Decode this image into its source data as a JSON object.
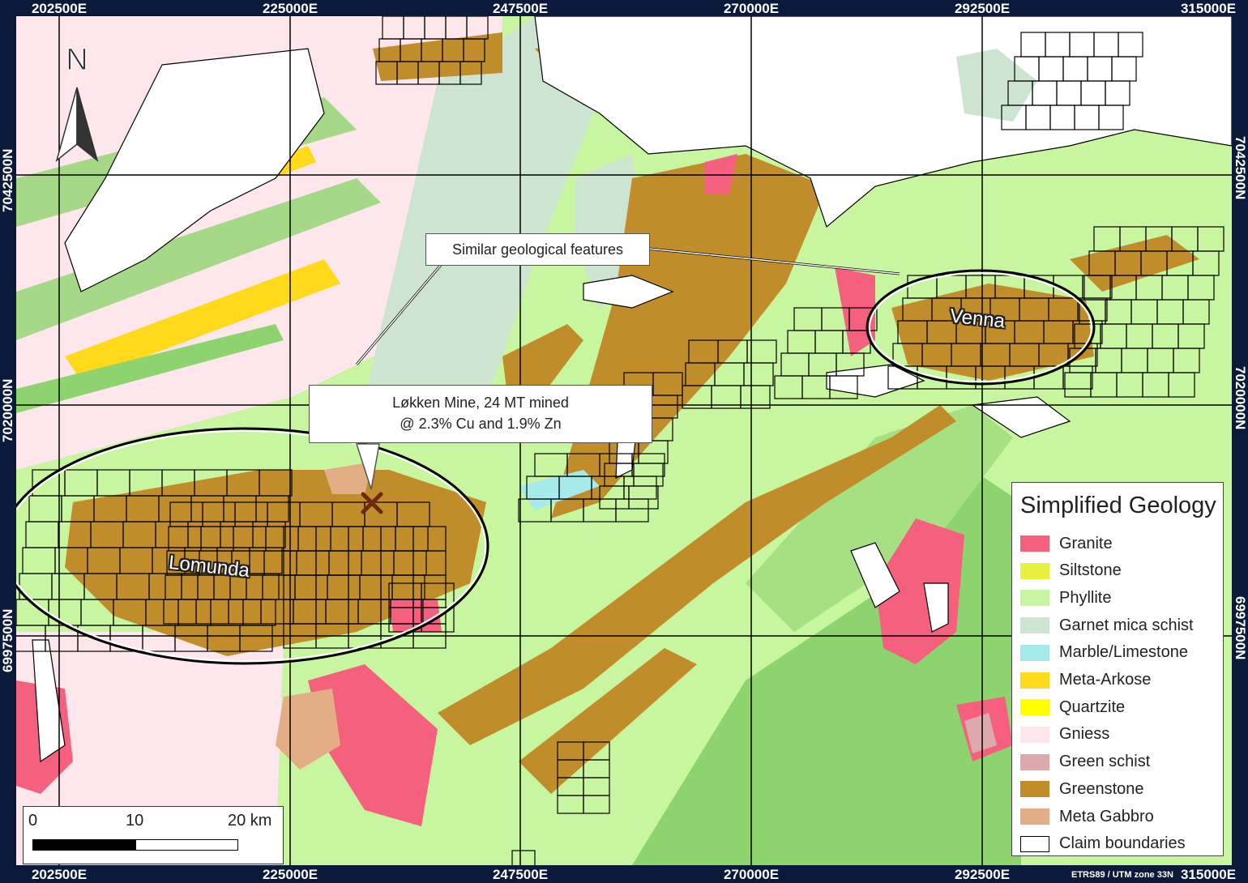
{
  "coordinates": {
    "top_x": [
      "202500E",
      "225000E",
      "247500E",
      "270000E",
      "292500E",
      "315000E"
    ],
    "bottom_x": [
      "202500E",
      "225000E",
      "247500E",
      "270000E",
      "292500E",
      "315000E"
    ],
    "left_y": [
      "7042500N",
      "7020000N",
      "6997500N"
    ],
    "right_y": [
      "7042500N",
      "7020000N",
      "6997500N"
    ]
  },
  "crs_label": "ETRS89 / UTM zone 33N",
  "north_arrow": {
    "label": "N",
    "icon": "north-arrow-icon"
  },
  "callouts": {
    "similar": "Similar geological features",
    "mine_line1": "Løkken Mine, 24 MT mined",
    "mine_line2": "@ 2.3% Cu and 1.9% Zn"
  },
  "deposits": {
    "lomunda": "Lomunda",
    "venna": "Venna"
  },
  "mine_icon": "mine-pickaxes-icon",
  "legend": {
    "title": "Simplified Geology",
    "items": [
      {
        "label": "Granite",
        "color": "#f4607e"
      },
      {
        "label": "Siltstone",
        "color": "#e6f23c"
      },
      {
        "label": "Phyllite",
        "color": "#c8f5a0"
      },
      {
        "label": "Garnet mica schist",
        "color": "#cde4d0"
      },
      {
        "label": "Marble/Limestone",
        "color": "#a6ebeb"
      },
      {
        "label": "Meta-Arkose",
        "color": "#ffd91a"
      },
      {
        "label": "Quartzite",
        "color": "#ffff00"
      },
      {
        "label": "Gniess",
        "color": "#fde6ec"
      },
      {
        "label": "Green schist",
        "color": "#dca9ad"
      },
      {
        "label": "Greenstone",
        "color": "#c08d2a"
      },
      {
        "label": "Meta Gabbro",
        "color": "#e3ae85"
      },
      {
        "label": "Claim boundaries",
        "color": "#ffffff"
      }
    ]
  },
  "scale_bar": {
    "labels": [
      "0",
      "10",
      "20 km"
    ]
  },
  "colors": {
    "frame": "#0b1a3a",
    "water": "#ffffff",
    "grid": "#000000"
  }
}
